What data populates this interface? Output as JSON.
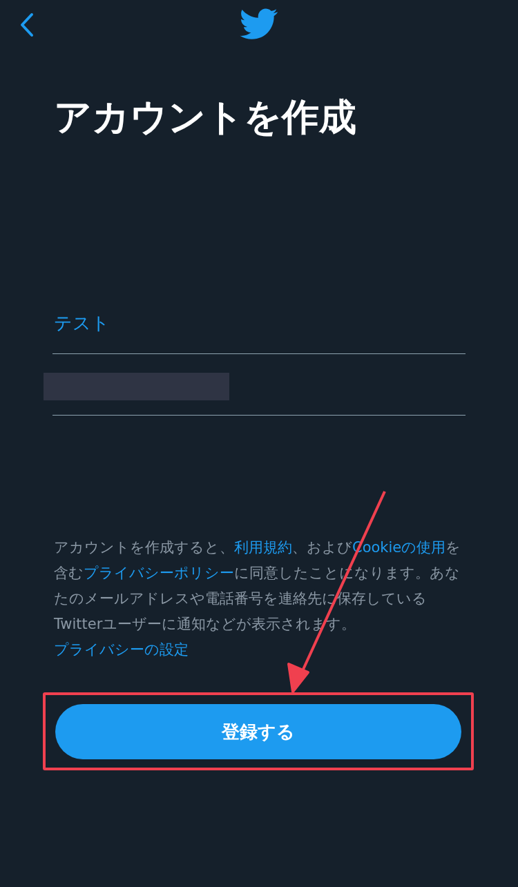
{
  "title": "アカウントを作成",
  "fields": [
    {
      "value": "テスト",
      "redacted": false
    },
    {
      "redacted": true
    }
  ],
  "notice": [
    {
      "text": "アカウントを作成すると、",
      "link": false
    },
    {
      "text": "利用規約",
      "link": true
    },
    {
      "text": "、および",
      "link": false
    },
    {
      "text": "Cookieの使用",
      "link": true
    },
    {
      "text": "を含む",
      "link": false
    },
    {
      "text": "プライバシーポリシー",
      "link": true
    },
    {
      "text": "に同意したことになります。あなたのメールアドレスや電話番号を連絡先に保存しているTwitterユーザーに通知などが表示されます。",
      "link": false
    },
    {
      "text": "プライバシーの設定",
      "link": true
    }
  ],
  "submit_button": "登録する",
  "annotations": {
    "highlight_box": true,
    "arrow": true
  }
}
